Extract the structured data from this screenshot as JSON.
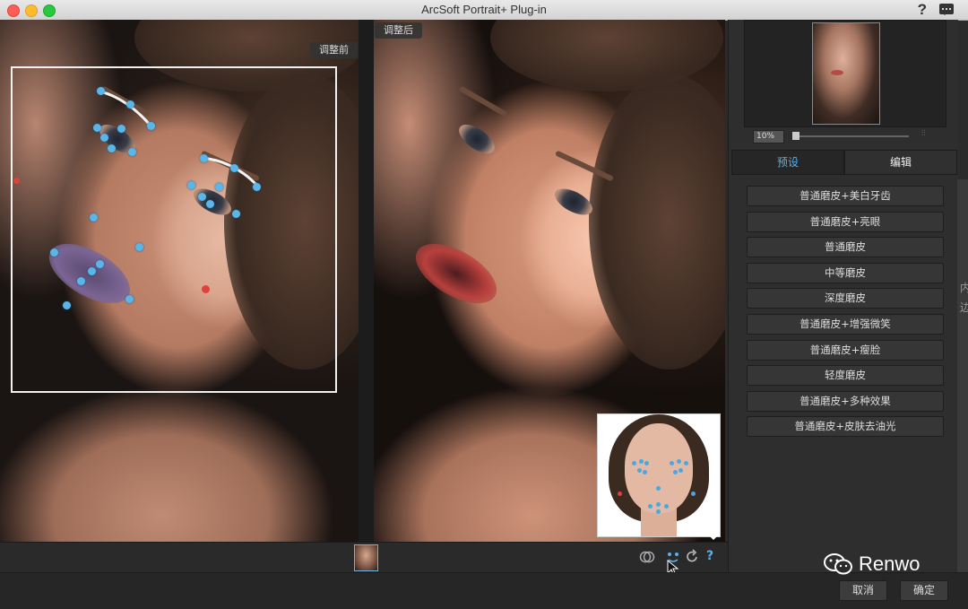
{
  "window": {
    "title": "ArcSoft Portrait+ Plug-in"
  },
  "preview": {
    "before_label": "调整前",
    "after_label": "调整后"
  },
  "navigator": {
    "zoom": "10%"
  },
  "tabs": [
    {
      "label": "预设",
      "active": true
    },
    {
      "label": "编辑",
      "active": false
    }
  ],
  "presets": [
    "普通磨皮+美白牙齿",
    "普通磨皮+亮眼",
    "普通磨皮",
    "中等磨皮",
    "深度磨皮",
    "普通磨皮+增强微笑",
    "普通磨皮+瘦脸",
    "轻度磨皮",
    "普通磨皮+多种效果",
    "普通磨皮+皮肤去油光"
  ],
  "footer": {
    "cancel": "取消",
    "ok": "确定"
  },
  "toolbar": {
    "help": "?"
  },
  "side_edge_text": [
    "内",
    "边"
  ],
  "watermark": "Renwo",
  "colors": {
    "accent": "#58b1ee",
    "landmark": "#5ab6e8",
    "marker_red": "#e0413a"
  }
}
